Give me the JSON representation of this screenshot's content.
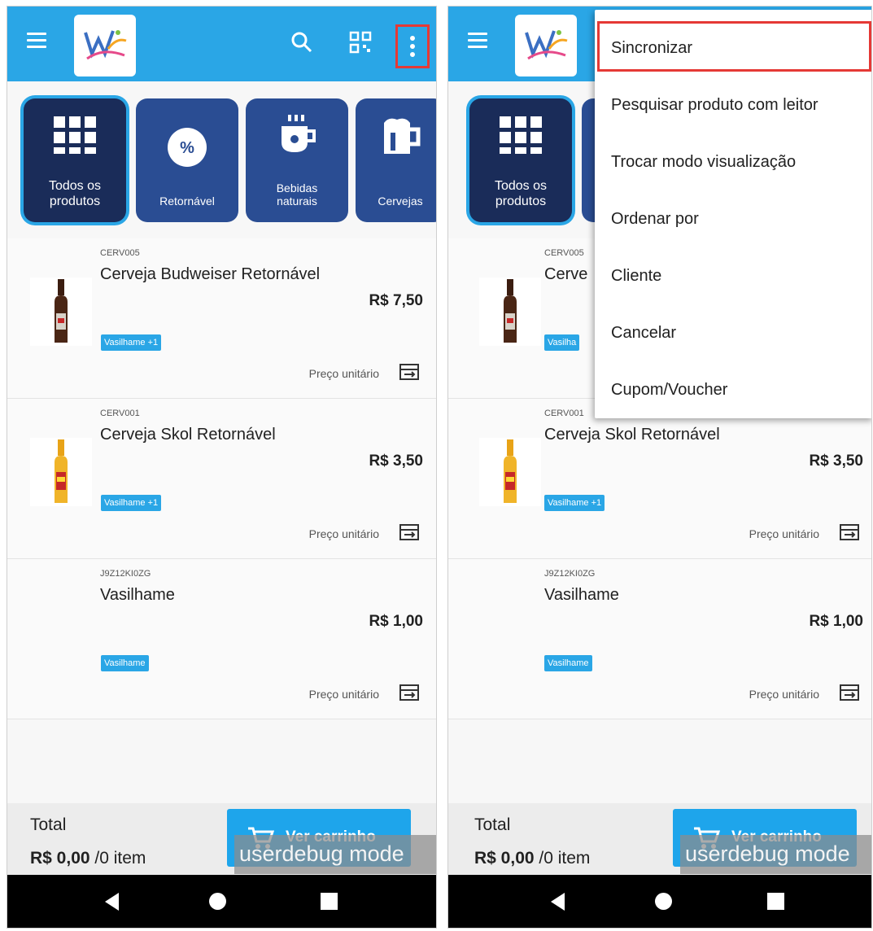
{
  "screens": {
    "left": {
      "categories": [
        {
          "label_line1": "Todos os",
          "label_line2": "produtos",
          "icon": "grid-icon"
        },
        {
          "label_line1": "Retornável",
          "label_line2": "",
          "icon": "percent-badge-icon"
        },
        {
          "label_line1": "Bebidas",
          "label_line2": "naturais",
          "icon": "cup-icon"
        },
        {
          "label_line1": "Cervejas",
          "label_line2": "",
          "icon": "beer-mug-icon"
        }
      ],
      "products": [
        {
          "code": "CERV005",
          "name": "Cerveja Budweiser Retornável",
          "price": "R$ 7,50",
          "tag": "Vasilhame +1",
          "unit": "Preço unitário",
          "image": "budweiser-bottle"
        },
        {
          "code": "CERV001",
          "name": "Cerveja Skol Retornável",
          "price": "R$ 3,50",
          "tag": "Vasilhame +1",
          "unit": "Preço unitário",
          "image": "skol-bottle"
        },
        {
          "code": "J9Z12KI0ZG",
          "name": "Vasilhame",
          "price": "R$ 1,00",
          "tag": "Vasilhame",
          "unit": "Preço unitário",
          "image": ""
        }
      ],
      "footer": {
        "total_label": "Total",
        "total_amount": "R$ 0,00",
        "total_items": " /0 item",
        "cart_button": "Ver carrinho"
      },
      "debug_overlay": "userdebug mode"
    },
    "right": {
      "categories": [
        {
          "label_line1": "Todos os",
          "label_line2": "produtos",
          "icon": "grid-icon"
        }
      ],
      "products": [
        {
          "code": "CERV005",
          "name": "Cerve",
          "tag": "Vasilha",
          "image": "budweiser-bottle"
        },
        {
          "code": "CERV001",
          "name": "Cerveja Skol Retornável",
          "price": "R$ 3,50",
          "tag": "Vasilhame +1",
          "unit": "Preço unitário",
          "image": "skol-bottle"
        },
        {
          "code": "J9Z12KI0ZG",
          "name": "Vasilhame",
          "price": "R$ 1,00",
          "tag": "Vasilhame",
          "unit": "Preço unitário",
          "image": ""
        }
      ],
      "menu": [
        {
          "label": "Sincronizar"
        },
        {
          "label": "Pesquisar produto com leitor"
        },
        {
          "label": "Trocar modo visualização"
        },
        {
          "label": "Ordenar por"
        },
        {
          "label": "Cliente"
        },
        {
          "label": "Cancelar"
        },
        {
          "label": "Cupom/Voucher"
        }
      ],
      "footer": {
        "total_label": "Total",
        "total_amount": "R$ 0,00",
        "total_items": " /0 item",
        "cart_button": "Ver carrinho"
      },
      "debug_overlay": "userdebug mode"
    }
  },
  "colors": {
    "appbar": "#2aa6e6",
    "category_bg": "#2a4d93",
    "category_active": "#1a2c59",
    "highlight": "#e53935",
    "tag": "#2aa6e6"
  }
}
